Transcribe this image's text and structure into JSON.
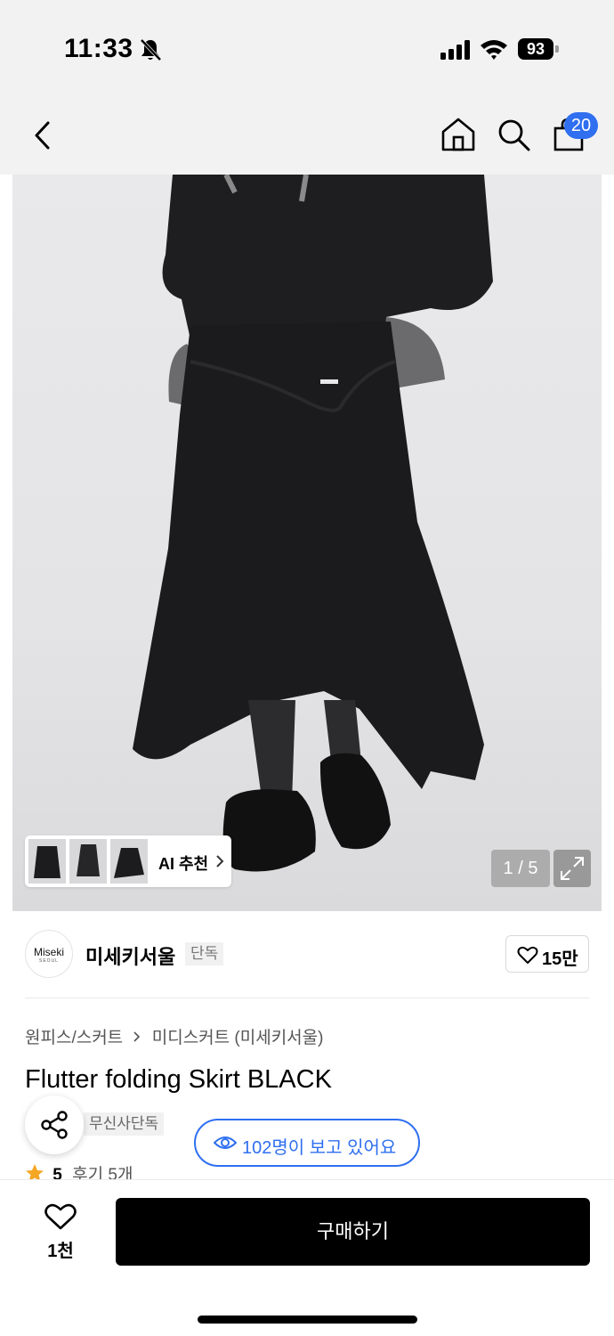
{
  "status_bar": {
    "time": "11:33",
    "battery": "93",
    "icons": [
      "bell-slash-icon",
      "signal-icon",
      "wifi-icon",
      "battery-icon"
    ]
  },
  "nav": {
    "icons": [
      "back-chevron-icon",
      "home-icon",
      "search-icon",
      "shopping-bag-icon"
    ],
    "cart_badge": "20"
  },
  "image": {
    "ai_recommend_label": "AI 추천",
    "counter": "1 / 5",
    "icons": [
      "chevron-right-icon",
      "expand-icon"
    ]
  },
  "brand": {
    "logo_text": "Miseki",
    "logo_subtext": "SEOUL",
    "name": "미세키서울",
    "tag": "단독",
    "likes": "15만",
    "icons": [
      "heart-icon"
    ]
  },
  "product": {
    "category": "원피스/스커트",
    "subcategory": "미디스커트 (미세키서울)",
    "title": "Flutter folding Skirt BLACK",
    "exclusive_tag": "무신사단독",
    "viewers": "102명이 보고 있어요",
    "rating": "5",
    "reviews": "후기 5개",
    "icons": [
      "share-icon",
      "eye-icon",
      "star-icon"
    ],
    "colors": {
      "accent_blue": "#2f6ff0",
      "star_orange": "#f5a623"
    }
  },
  "bottom": {
    "wish_count": "1천",
    "buy_label": "구매하기",
    "icons": [
      "heart-outline-icon"
    ]
  }
}
